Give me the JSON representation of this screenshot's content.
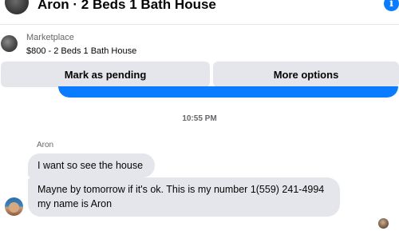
{
  "header": {
    "title": "Aron · 2 Beds 1 Bath House",
    "info_icon": "info-icon",
    "info_glyph": "i"
  },
  "listing": {
    "source": "Marketplace",
    "name": "$800 - 2 Beds 1 Bath House"
  },
  "actions": {
    "mark_pending_label": "Mark as pending",
    "more_options_label": "More options"
  },
  "conversation": {
    "timestamp": "10:55 PM",
    "sender_name": "Aron",
    "messages": [
      "I want so see the house",
      "Mayne by tomorrow if it's ok. This is my number 1(559) 241-4994 my name is Aron"
    ]
  },
  "colors": {
    "accent": "#0a7cff",
    "bubble": "#e4e6eb",
    "secondary_text": "#65676b"
  }
}
